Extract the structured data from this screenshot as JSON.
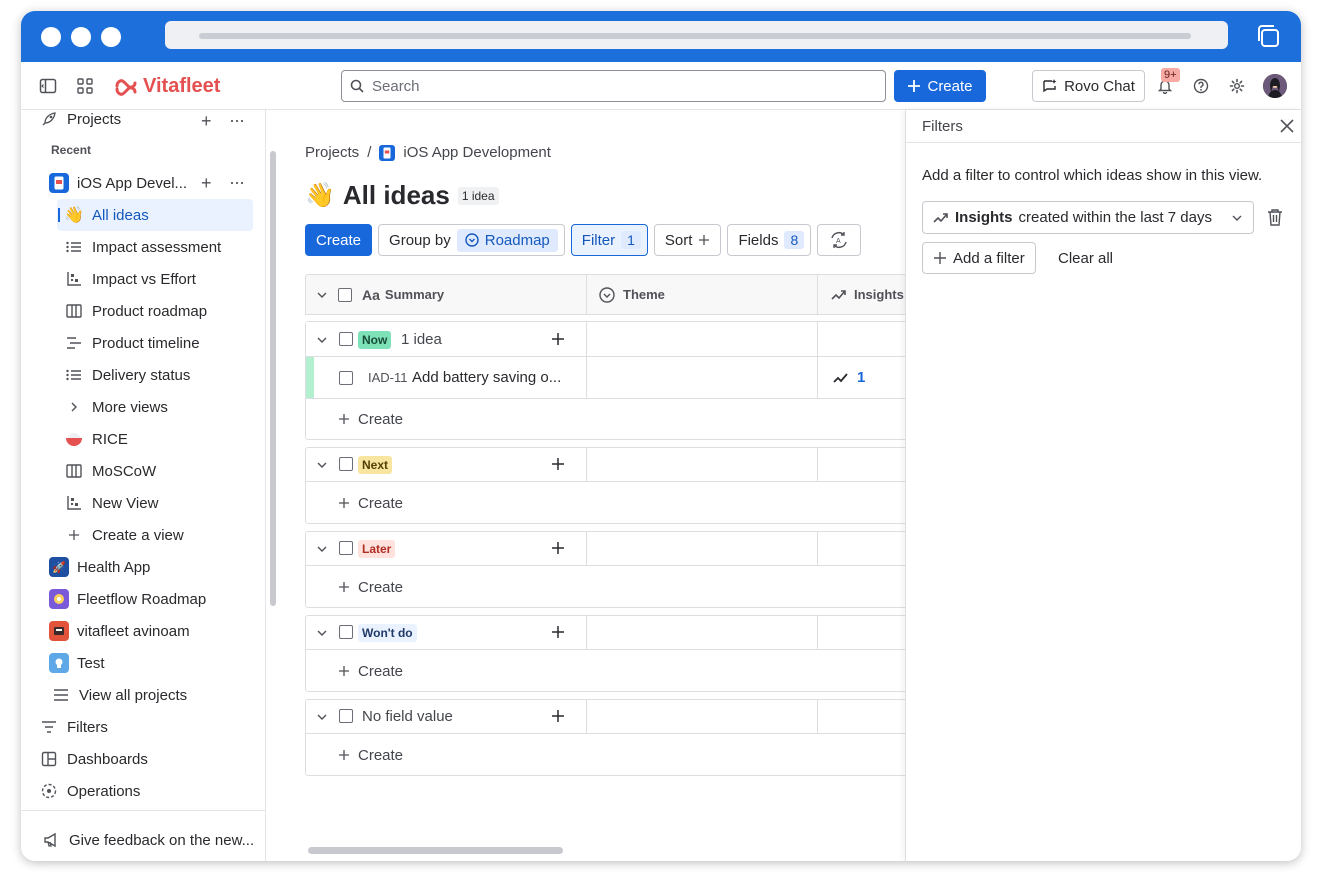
{
  "topnav": {
    "search_placeholder": "Search",
    "create_label": "Create",
    "rovo_label": "Rovo Chat",
    "notif_count": "9+",
    "brand": "Vitafleet"
  },
  "sidebar": {
    "projects_label": "Projects",
    "recent_label": "Recent",
    "current_project": "iOS App Devel...",
    "views": [
      {
        "label": "All ideas",
        "icon": "waving-hand-icon"
      },
      {
        "label": "Impact assessment",
        "icon": "list-icon"
      },
      {
        "label": "Impact vs Effort",
        "icon": "matrix-icon"
      },
      {
        "label": "Product roadmap",
        "icon": "board-icon"
      },
      {
        "label": "Product timeline",
        "icon": "timeline-icon"
      },
      {
        "label": "Delivery status",
        "icon": "list-icon"
      },
      {
        "label": "More views",
        "icon": "chevron-right-icon"
      },
      {
        "label": "RICE",
        "icon": "bowl-icon"
      },
      {
        "label": "MoSCoW",
        "icon": "board-icon"
      },
      {
        "label": "New View",
        "icon": "matrix-icon"
      },
      {
        "label": "Create a view",
        "icon": "plus-icon"
      }
    ],
    "projects": [
      {
        "label": "Health App",
        "color": "#1f4fa0"
      },
      {
        "label": "Fleetflow Roadmap",
        "color": "#7a5ad8"
      },
      {
        "label": "vitafleet avinoam",
        "color": "#e2533b"
      },
      {
        "label": "Test",
        "color": "#5fa8e8"
      }
    ],
    "view_all_label": "View all projects",
    "filters_label": "Filters",
    "dashboards_label": "Dashboards",
    "operations_label": "Operations",
    "feedback_label": "Give feedback on the new..."
  },
  "main": {
    "breadcrumb_root": "Projects",
    "breadcrumb_sep": "/",
    "breadcrumb_project": "iOS App Development",
    "title": "All ideas",
    "idea_count": "1 idea",
    "toolbar": {
      "create": "Create",
      "group_by": "Group by",
      "group_value": "Roadmap",
      "filter": "Filter",
      "filter_count": "1",
      "sort": "Sort",
      "fields": "Fields",
      "fields_count": "8"
    },
    "columns": {
      "summary_prefix": "Aa",
      "summary": "Summary",
      "theme": "Theme",
      "insights": "Insights"
    },
    "groups": [
      {
        "label": "Now",
        "bg": "#7ee2b8",
        "fg": "#164b35",
        "count": "1 idea"
      },
      {
        "label": "Next",
        "bg": "#f8e6a0",
        "fg": "#533f04",
        "count": ""
      },
      {
        "label": "Later",
        "bg": "#ffe2dd",
        "fg": "#ae2e24",
        "count": ""
      },
      {
        "label": "Won't do",
        "bg": "#e9f2fe",
        "fg": "#1f3a68",
        "count": ""
      },
      {
        "label": "No field value",
        "bg": "transparent",
        "fg": "#292a2e",
        "count": ""
      }
    ],
    "idea": {
      "key": "IAD-11",
      "summary": "Add battery saving o...",
      "insights": "1"
    },
    "create_row_label": "Create"
  },
  "filters_panel": {
    "title": "Filters",
    "description": "Add a filter to control which ideas show in this view.",
    "filter_field": "Insights",
    "filter_condition": "created within the last 7 days",
    "add_filter": "Add a filter",
    "clear_all": "Clear all"
  }
}
